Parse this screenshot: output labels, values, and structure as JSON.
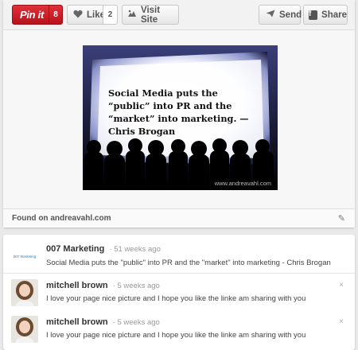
{
  "toolbar": {
    "pinit_label": "Pin it",
    "pinit_count": "8",
    "like_label": "Like",
    "like_count": "2",
    "visit_label": "Visit Site",
    "send_label": "Send",
    "share_label": "Share"
  },
  "pin": {
    "quote": "Social Media puts the “public” into PR and the “market” into marketing. — Chris Brogan",
    "credit": "www.andreavahl.com"
  },
  "found": {
    "label": "Found on andreavahl.com"
  },
  "comments": [
    {
      "name": "007 Marketing",
      "time": "· 51 weeks ago",
      "text": "Social Media puts the \"public\" into PR and the \"market\" into marketing - Chris Brogan",
      "avatar_text": "007 Marketing"
    },
    {
      "name": "mitchell brown",
      "time": "· 5 weeks ago",
      "text": "I love your page nice picture and I hope you like the linke am sharing with you",
      "close": "×"
    },
    {
      "name": "mitchell brown",
      "time": "· 5 weeks ago",
      "text": "I love your page nice picture and I hope you like the linke am sharing with you",
      "close": "×"
    }
  ],
  "colors": {
    "pinit_red": "#cb2027",
    "page_bg": "#e9e9e9"
  },
  "icons": [
    "heart-icon",
    "visit-site-icon",
    "send-icon",
    "facebook-icon",
    "pencil-icon",
    "close-icon"
  ]
}
